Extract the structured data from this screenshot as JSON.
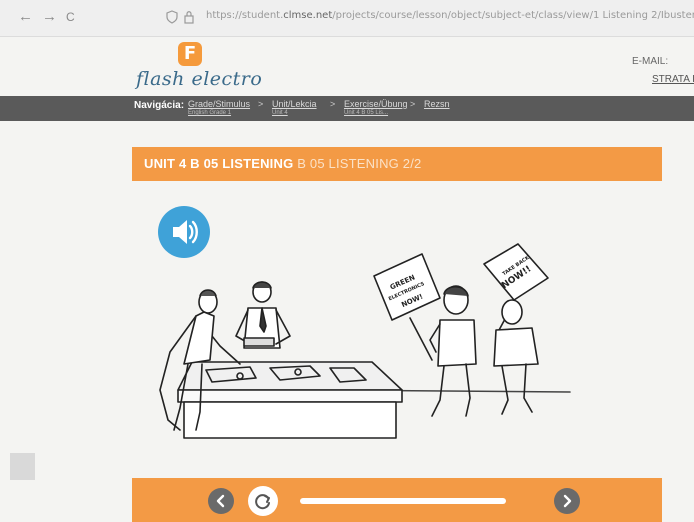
{
  "browser": {
    "back_icon": "←",
    "forward_icon": "→",
    "reload_icon": "C",
    "url_prefix": "https://student.",
    "url_domain": "clmse.net",
    "url_path": "/projects/course/lesson/object/subject-et/class/view/1  Listening 2/Ibuster..."
  },
  "header": {
    "logo_mark": "F",
    "logo_text": "flash electro",
    "email_label": "E-MAIL:",
    "email_value": "",
    "strata_link": "STRATA H"
  },
  "breadcrumb": {
    "title": "Navigácia:",
    "items": [
      {
        "label": "Grade/Stimulus",
        "sub": "English Grade 1"
      },
      {
        "label": "Unit/Lekcia",
        "sub": "Unit 4"
      },
      {
        "label": "Exercise/Übung",
        "sub": "Unit 4 B 05 Lis..."
      },
      {
        "label": "Rezsn",
        "sub": ""
      }
    ],
    "separator": ">"
  },
  "unit": {
    "title": "UNIT 4 B 05 LISTENING",
    "subtitle": "B 05 LISTENING 2/2"
  },
  "illustration": {
    "sign1": [
      "GREEN",
      "ELECTRONICS",
      "NOW!"
    ],
    "sign2": [
      "TAKE BACK",
      "NOW!!"
    ]
  },
  "colors": {
    "accent_orange": "#f39a45",
    "audio_blue": "#3fa2d8",
    "breadcrumb_gray": "#5a5a5a"
  },
  "controls": {
    "prev_icon": "chevron-left-icon",
    "replay_icon": "replay-icon",
    "next_icon": "chevron-right-icon"
  }
}
